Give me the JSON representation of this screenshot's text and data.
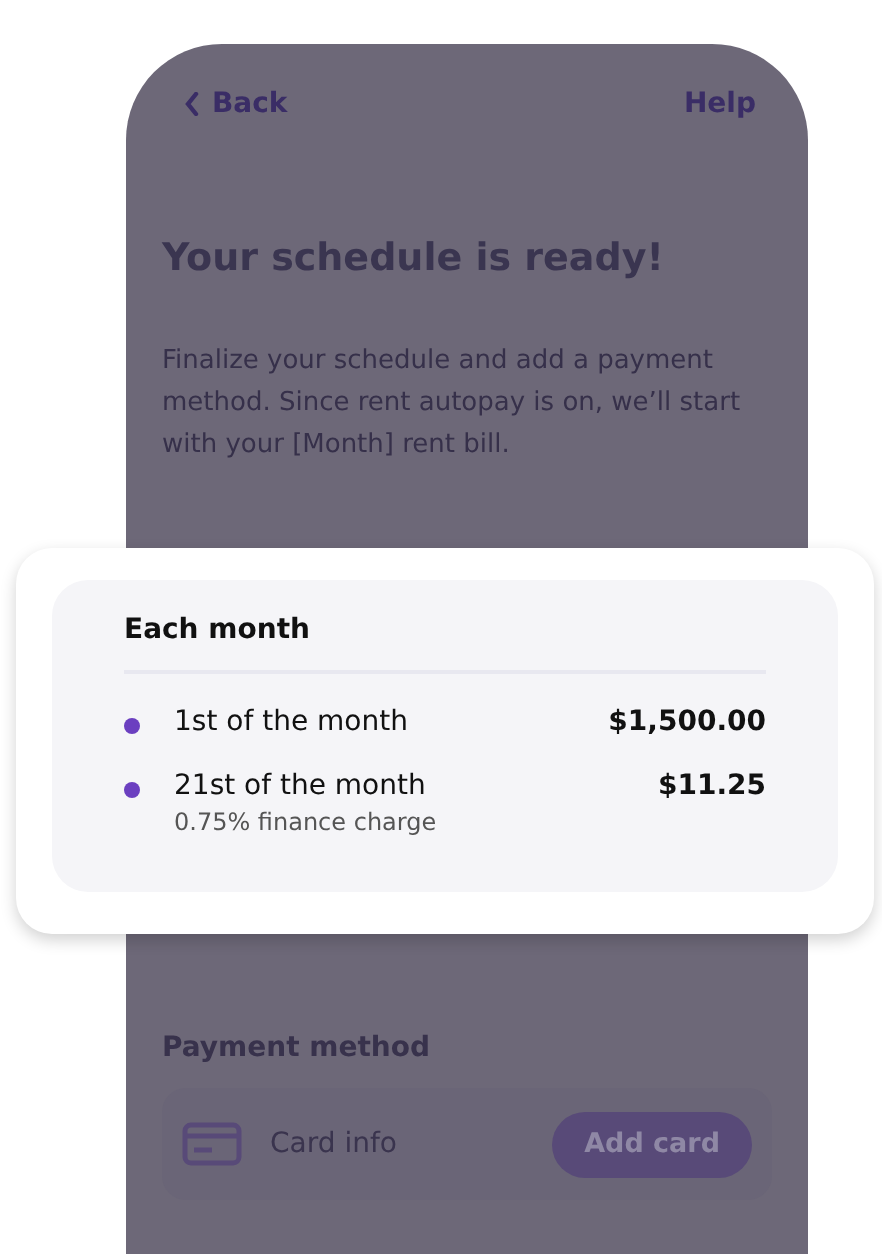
{
  "header": {
    "back": "Back",
    "help": "Help"
  },
  "title": "Your schedule is ready!",
  "description": "Finalize your schedule and add a payment method. Since rent autopay is on, we’ll start with your [Month] rent bill.",
  "schedule": {
    "heading": "Each month",
    "items": [
      {
        "label": "1st of the month",
        "amount": "$1,500.00",
        "color": "#6b3fc0"
      },
      {
        "label": "21st of the month",
        "amount": "$11.25",
        "note": "0.75% finance charge",
        "color": "#6b3fc0"
      }
    ]
  },
  "payment": {
    "label": "Payment method",
    "placeholder": "Card info",
    "button": "Add card"
  }
}
